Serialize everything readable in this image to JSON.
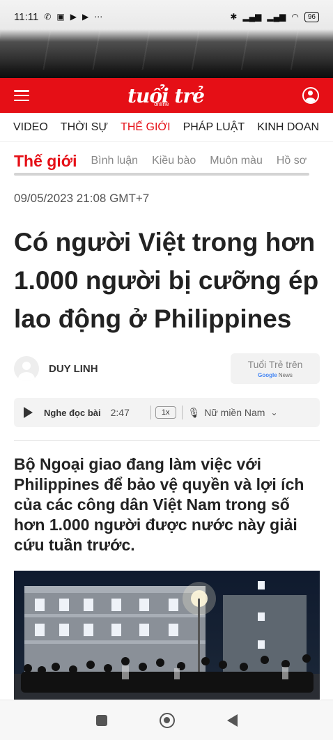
{
  "status_bar": {
    "time": "11:11",
    "notification_icons": [
      "missed-call-icon",
      "zalo-icon",
      "play-icon",
      "play-icon",
      "more-dots-icon"
    ],
    "right_icons": [
      "bluetooth-icon",
      "signal-icon",
      "signal-icon",
      "wifi-icon"
    ],
    "battery": "96"
  },
  "header": {
    "logo_text": "tuổi trẻ",
    "logo_sub": "online",
    "brand_color": "#e50f16"
  },
  "main_nav": {
    "items": [
      "VIDEO",
      "THỜI SỰ",
      "THẾ GIỚI",
      "PHÁP LUẬT",
      "KINH DOAN"
    ],
    "active_index": 2
  },
  "sub_nav": {
    "title": "Thế giới",
    "items": [
      "Bình luận",
      "Kiều bào",
      "Muôn màu",
      "Hồ sơ"
    ]
  },
  "article": {
    "date": "09/05/2023 21:08 GMT+7",
    "title": "Có người Việt trong hơn 1.000 người bị cưỡng ép lao động ở Philippines",
    "author": "DUY LINH",
    "google_news": {
      "line1": "Tuổi Trẻ trên",
      "google": "Google",
      "news": "News"
    },
    "audio": {
      "label": "Nghe đọc bài",
      "duration": "2:47",
      "speed": "1x",
      "voice": "Nữ miền Nam"
    },
    "sapo": "Bộ Ngoại giao đang làm việc với Philippines để bảo vệ quyền và lợi ích của các công dân Việt Nam trong số hơn 1.000 người được nước này giải cứu tuần trước."
  }
}
